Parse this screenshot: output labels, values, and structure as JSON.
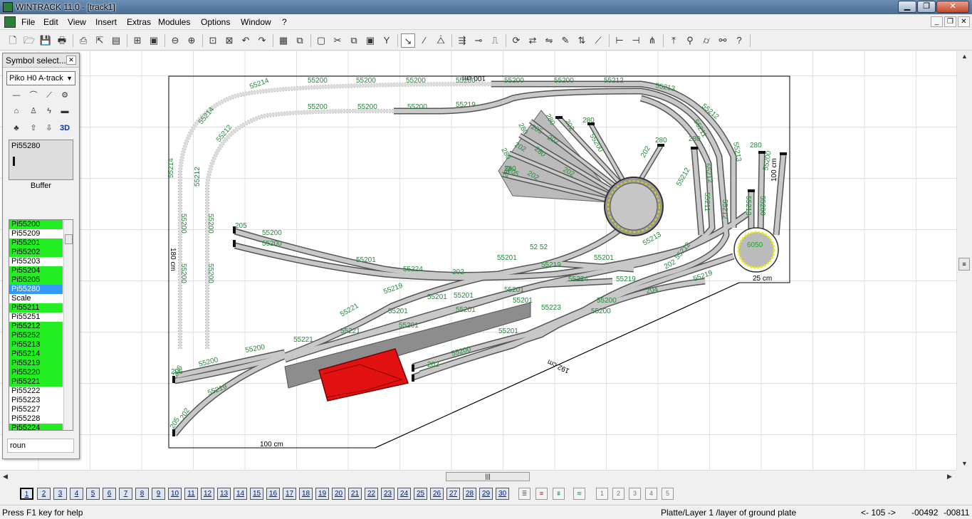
{
  "window": {
    "title": "WINTRACK 11.0 - [track1]"
  },
  "menu": [
    "File",
    "Edit",
    "View",
    "Insert",
    "Extras",
    "Modules",
    "Options",
    "Window",
    "?"
  ],
  "toolbar_icons": [
    "new-icon",
    "open-icon",
    "save-icon",
    "print-icon",
    "print-preview-icon",
    "export-icon",
    "library-icon",
    "grid-icon",
    "image-icon",
    "zoom-out-icon",
    "zoom-in-icon",
    "zoom-window-icon",
    "zoom-fit-icon",
    "undo-icon",
    "redo-icon",
    "delete-icon",
    "copy-icon",
    "paste-icon",
    "cut-icon",
    "duplicate-icon",
    "clipboard-icon",
    "switch-icon",
    "select-icon",
    "draw-icon",
    "align-icon",
    "connect-icon",
    "join-icon",
    "measure-icon",
    "rotate-icon",
    "flip-icon",
    "mirror-icon",
    "mark-icon",
    "height-icon",
    "slope-icon",
    "track-icon",
    "gap-icon",
    "insulate-icon",
    "elevate-icon",
    "signal-icon",
    "catenary-icon",
    "wire-icon",
    "help-icon"
  ],
  "symbol_panel": {
    "title": "Symbol select...",
    "catalog": "Piko H0 A-track",
    "preview_name": "Pi55280",
    "preview_caption": "Buffer",
    "list": [
      {
        "name": "Pi55200",
        "green": true
      },
      {
        "name": "Pi55209",
        "green": false
      },
      {
        "name": "Pi55201",
        "green": true
      },
      {
        "name": "Pi55202",
        "green": true
      },
      {
        "name": "Pi55203",
        "green": false
      },
      {
        "name": "Pi55204",
        "green": true
      },
      {
        "name": "Pi55205",
        "green": true
      },
      {
        "name": "Pi55280",
        "green": false,
        "selected": true
      },
      {
        "name": "Scale",
        "green": false
      },
      {
        "name": "Pi55211",
        "green": true
      },
      {
        "name": "Pi55251",
        "green": false
      },
      {
        "name": "Pi55212",
        "green": true
      },
      {
        "name": "Pi55252",
        "green": true
      },
      {
        "name": "Pi55213",
        "green": true
      },
      {
        "name": "Pi55214",
        "green": true
      },
      {
        "name": "Pi55219",
        "green": true
      },
      {
        "name": "Pi55220",
        "green": true
      },
      {
        "name": "Pi55221",
        "green": true
      },
      {
        "name": "Pi55222",
        "green": false
      },
      {
        "name": "Pi55223",
        "green": false
      },
      {
        "name": "Pi55227",
        "green": false
      },
      {
        "name": "Pi55228",
        "green": false
      },
      {
        "name": "Pi55224",
        "green": true
      }
    ],
    "search": "roun"
  },
  "layout": {
    "dimension_labels": {
      "width": "100 cm",
      "height": "180 cm",
      "diag": "192 cm",
      "right_height": "100 cm",
      "turntable_width": "25 cm",
      "top": "100 cm"
    },
    "turntable_label": "6050",
    "track_labels": [
      "55214",
      "55200",
      "55200",
      "55200",
      "55200",
      "55213",
      "55212",
      "55214",
      "55212",
      "55200",
      "55200",
      "55200",
      "55219",
      "55200",
      "55200",
      "55212",
      "55211",
      "55213",
      "55214",
      "55212",
      "55200",
      "55200",
      "55200",
      "55200",
      "205",
      "280",
      "280",
      "202",
      "280",
      "280",
      "205",
      "202",
      "280",
      "202",
      "280",
      "55200",
      "202",
      "280",
      "280",
      "55212",
      "202",
      "280",
      "280",
      "205",
      "202",
      "55212",
      "55211",
      "55213",
      "55212",
      "55200",
      "55200",
      "206",
      "55219",
      "55213",
      "55212",
      "55200",
      "55200",
      "55201",
      "52 52",
      "55201",
      "55201",
      "55221",
      "55224",
      "202",
      "55219",
      "202",
      "55219",
      "55200",
      "55200",
      "204",
      "55201",
      "55201",
      "55201",
      "55201",
      "55221",
      "55201",
      "55201",
      "55201",
      "55223",
      "55221",
      "55224",
      "55200",
      "55200",
      "55201",
      "202",
      "55200",
      "55219",
      "205",
      "202",
      "206",
      "55219"
    ]
  },
  "layers": {
    "first": "1",
    "numbers": [
      "2",
      "3",
      "4",
      "5",
      "6",
      "7",
      "8",
      "9",
      "10",
      "11",
      "12",
      "13",
      "14",
      "15",
      "16",
      "17",
      "18",
      "19",
      "20",
      "21",
      "22",
      "23",
      "24",
      "25",
      "26",
      "27",
      "28",
      "29",
      "30"
    ],
    "views": [
      "1",
      "2",
      "3",
      "4",
      "5"
    ]
  },
  "status": {
    "help": "Press F1 key for help",
    "layer": "Platte/Layer 1 /layer of ground plate",
    "zoom": "<- 105 ->",
    "x": "-00492",
    "y": "-00811"
  }
}
